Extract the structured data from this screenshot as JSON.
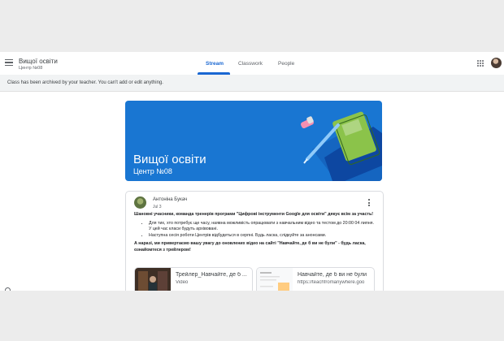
{
  "header": {
    "class_title": "Вищої освіти",
    "class_section": "Центр №08",
    "tabs": [
      {
        "label": "Stream",
        "active": true
      },
      {
        "label": "Classwork",
        "active": false
      },
      {
        "label": "People",
        "active": false
      }
    ]
  },
  "notice": "Class has been archived by your teacher. You can't add or edit anything.",
  "banner": {
    "title": "Вищої освіти",
    "subtitle": "Центр №08",
    "color": "#1976d2"
  },
  "post": {
    "author": "Антоніна Букач",
    "date": "Jul 3",
    "intro": "Шановні учасники, команда тренерів програми \"Цифрові інструменти Google для освіти\" дякує всім за участь!",
    "bullets": [
      "Для тих, хто потребує ще часу, наявна можливість опрацювати з навчальним відео та тестом до 20:00 04 липня. У цей час класи будуть архівовані.",
      "Наступна сесія роботи Центрів відбудеться в серпні. Будь ласка, слідкуйте за анонсами."
    ],
    "closing": "А наразі, ми привертаємо вашу увагу до оновлених відео на сайті \"Навчайте, де б ви не були\" - будь ласка, ознайомтеся з трейлером!",
    "attachments": [
      {
        "title": "Трейлер_Навчайте, де б ...",
        "subtitle": "Video"
      },
      {
        "title": "Навчайте, де б ви не були",
        "subtitle": "https://teachfromanywhere.goo"
      }
    ]
  },
  "accent_color": "#1967d2"
}
